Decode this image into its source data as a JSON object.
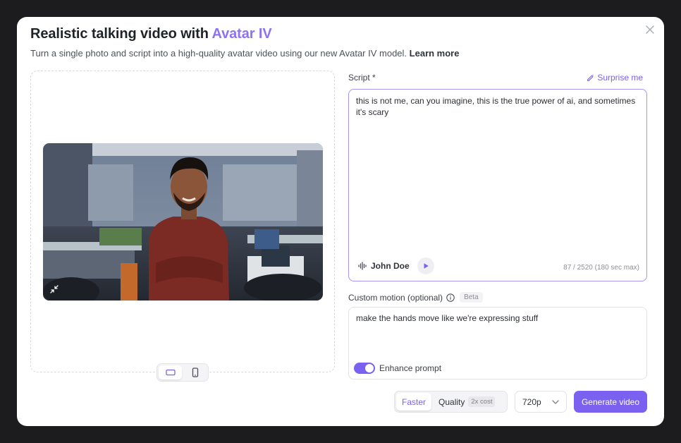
{
  "header": {
    "title_prefix": "Realistic talking video with ",
    "title_accent": "Avatar IV",
    "subtitle": "Turn a single photo and script into a high-quality avatar video using our new Avatar IV model.",
    "learn_more": "Learn more"
  },
  "script": {
    "label": "Script *",
    "surprise_label": "Surprise me",
    "text": "this is not me, can you imagine, this is the true power of ai, and sometimes it's scary",
    "voice_name": "John Doe",
    "char_count": "87 / 2520 (180 sec max)"
  },
  "motion": {
    "label": "Custom motion (optional)",
    "badge": "Beta",
    "text": "make the hands move like we're expressing stuff",
    "enhance_label": "Enhance prompt",
    "enhance_on": true
  },
  "controls": {
    "mode_faster": "Faster",
    "mode_quality": "Quality",
    "quality_cost": "2x cost",
    "resolution": "720p",
    "generate_label": "Generate video"
  },
  "colors": {
    "accent": "#7b61ef",
    "accent_light": "#8c73f0"
  },
  "icons": {
    "close": "close-icon",
    "surprise": "pencil-sparkle-icon",
    "voice": "audio-wave-icon",
    "play": "play-icon",
    "info": "info-icon",
    "collapse": "collapse-icon",
    "landscape": "landscape-icon",
    "portrait": "phone-icon",
    "dropdown": "chevron-down-icon"
  }
}
